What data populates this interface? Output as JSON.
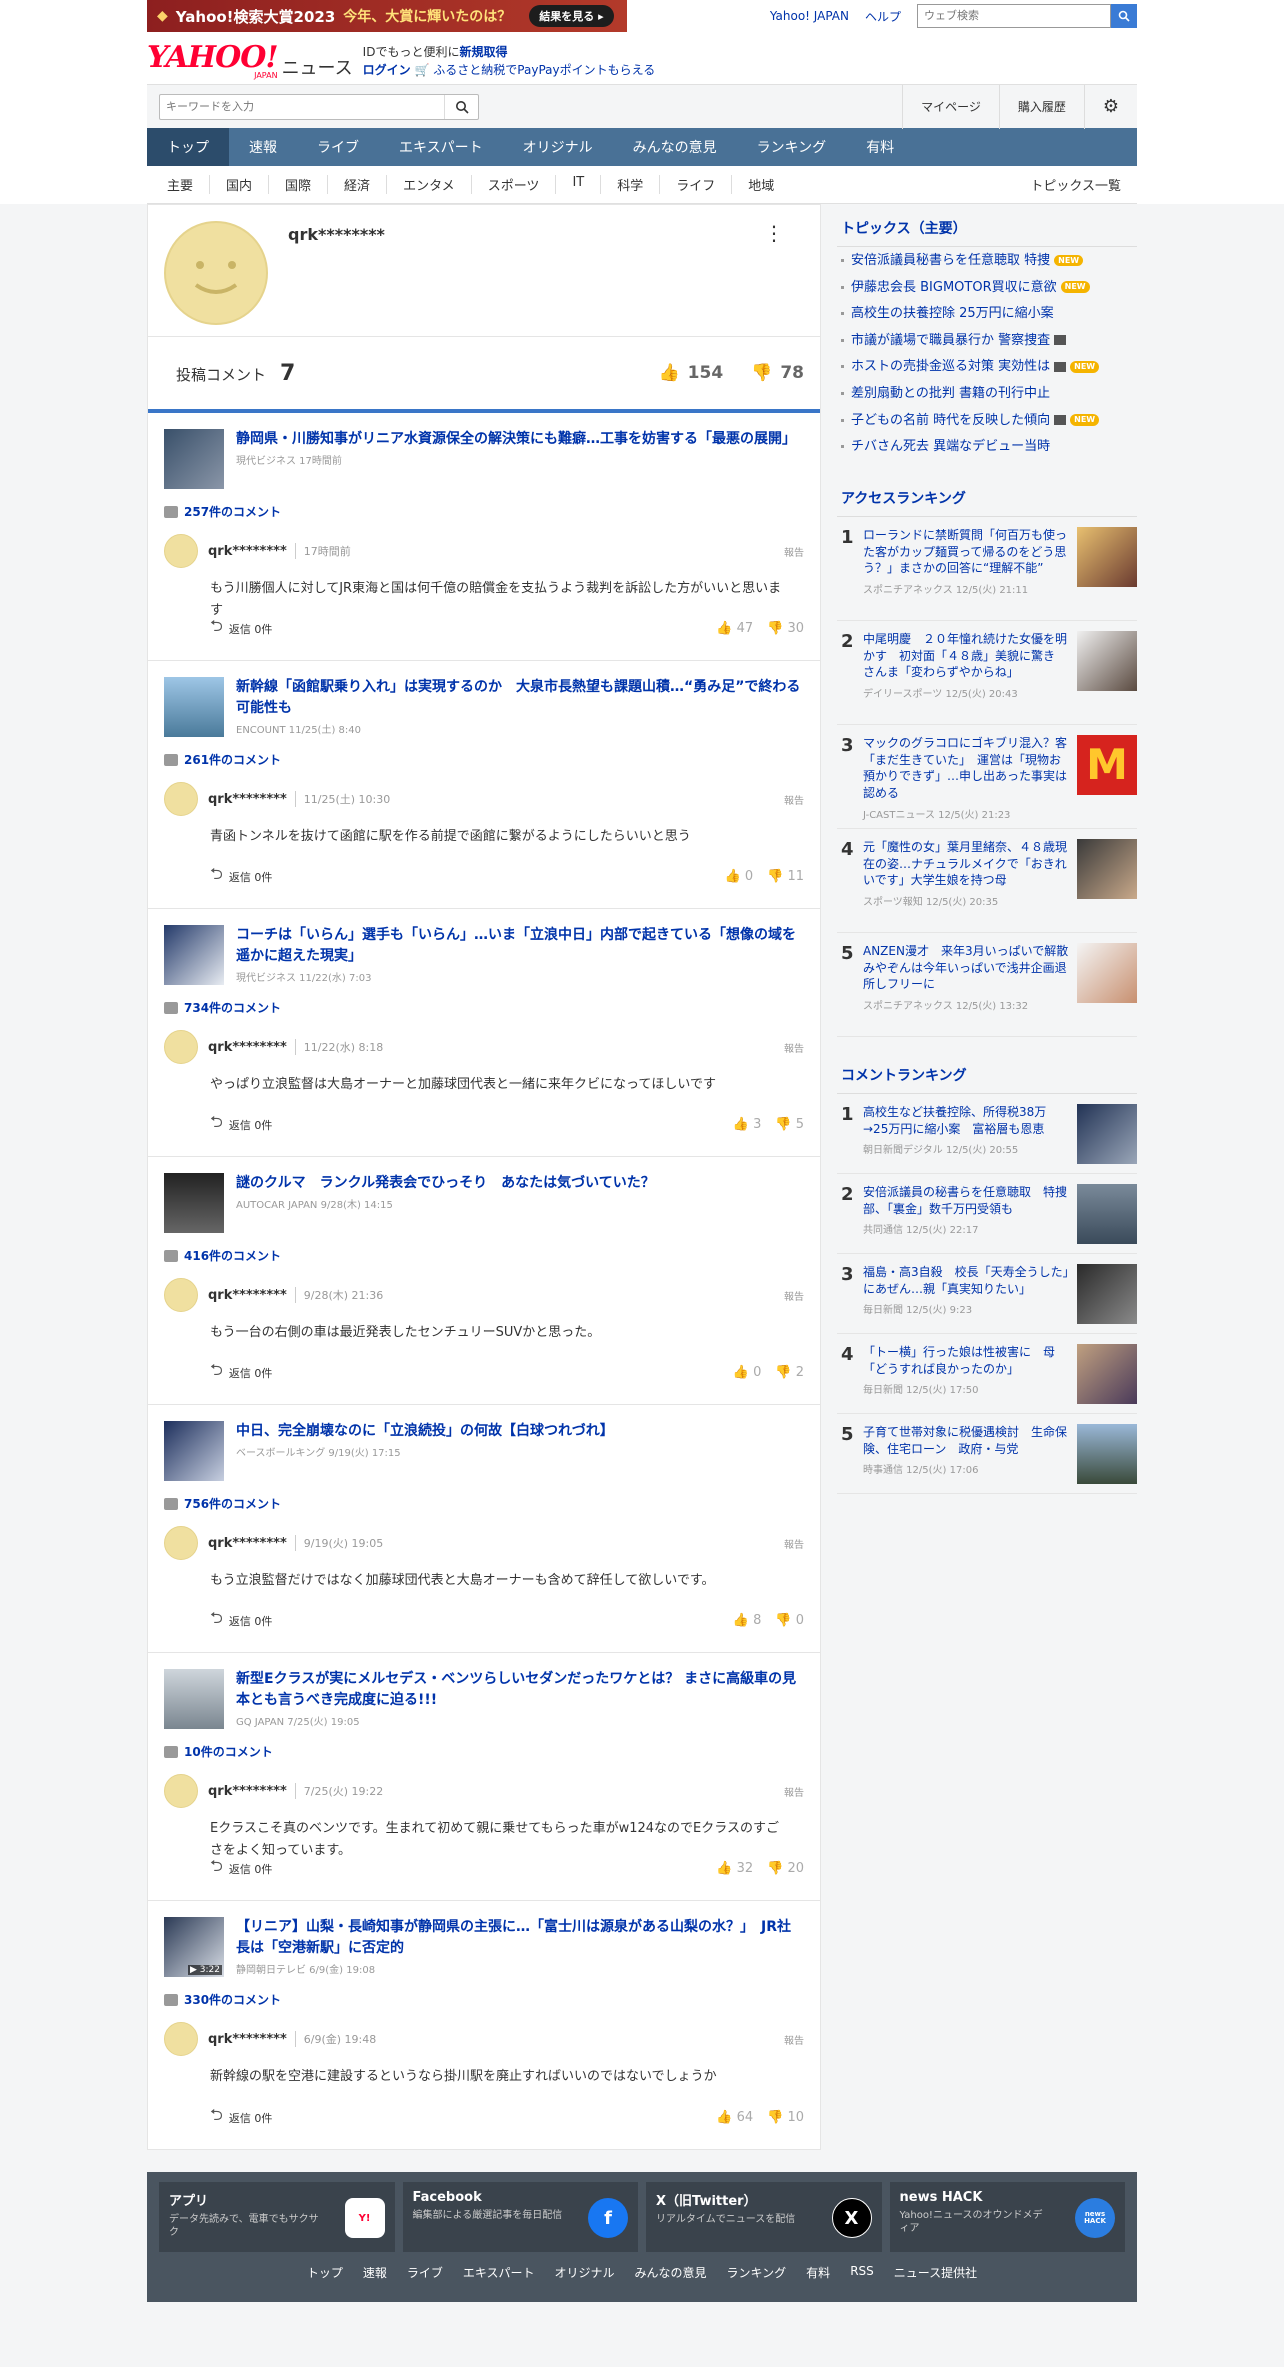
{
  "banner": {
    "title": "Yahoo!検索大賞2023",
    "subtitle": "今年、大賞に輝いたのは？",
    "button": "結果を見る ▸"
  },
  "top_links": {
    "yahoo_japan": "Yahoo! JAPAN",
    "help": "ヘルプ",
    "web_search_placeholder": "ウェブ検索"
  },
  "logo": {
    "yahoo": "YAHOO!",
    "japan": "JAPAN",
    "news": "ニュース"
  },
  "header_promo": {
    "line1_prefix": "IDでもっと便利に",
    "line1_link": "新規取得",
    "line2_login": "ログイン",
    "line2_text": "ふるさと納税でPayPayポイントもらえる"
  },
  "search": {
    "placeholder": "キーワードを入力"
  },
  "right_links": [
    "マイページ",
    "購入履歴"
  ],
  "nav": [
    "トップ",
    "速報",
    "ライブ",
    "エキスパート",
    "オリジナル",
    "みんなの意見",
    "ランキング",
    "有料"
  ],
  "subnav": [
    "主要",
    "国内",
    "国際",
    "経済",
    "エンタメ",
    "スポーツ",
    "IT",
    "科学",
    "ライフ",
    "地域"
  ],
  "subnav_all": "トピックス一覧",
  "profile": {
    "name": "qrk********",
    "comment_label": "投稿コメント",
    "comment_count": "7",
    "likes": "154",
    "dislikes": "78"
  },
  "comments": [
    {
      "title": "静岡県・川勝知事がリニア水資源保全の解決策にも難癖…工事を妨害する「最悪の展開」",
      "source": "現代ビジネス 17時間前",
      "count": "257件のコメント",
      "user": "qrk********",
      "date": "17時間前",
      "report": "報告",
      "text": "もう川勝個人に対してJR東海と国は何千億の賠償金を支払うよう裁判を訴訟した方がいいと思います",
      "reply": "返信 0件",
      "up": "47",
      "down": "30"
    },
    {
      "title": "新幹線「函館駅乗り入れ」は実現するのか　大泉市長熱望も課題山積…“勇み足”で終わる可能性も",
      "source": "ENCOUNT 11/25(土) 8:40",
      "count": "261件のコメント",
      "user": "qrk********",
      "date": "11/25(土) 10:30",
      "report": "報告",
      "text": "青函トンネルを抜けて函館に駅を作る前提で函館に繋がるようにしたらいいと思う",
      "reply": "返信 0件",
      "up": "0",
      "down": "11"
    },
    {
      "title": "コーチは「いらん」選手も「いらん」…いま「立浪中日」内部で起きている「想像の域を遥かに超えた現実」",
      "source": "現代ビジネス 11/22(水) 7:03",
      "count": "734件のコメント",
      "user": "qrk********",
      "date": "11/22(水) 8:18",
      "report": "報告",
      "text": "やっぱり立浪監督は大島オーナーと加藤球団代表と一緒に来年クビになってほしいです",
      "reply": "返信 0件",
      "up": "3",
      "down": "5"
    },
    {
      "title": "謎のクルマ　ランクル発表会でひっそり　あなたは気づいていた？",
      "source": "AUTOCAR JAPAN 9/28(木) 14:15",
      "count": "416件のコメント",
      "user": "qrk********",
      "date": "9/28(木) 21:36",
      "report": "報告",
      "text": "もう一台の右側の車は最近発表したセンチュリーSUVかと思った。",
      "reply": "返信 0件",
      "up": "0",
      "down": "2"
    },
    {
      "title": "中日、完全崩壊なのに「立浪続投」の何故【白球つれづれ】",
      "source": "ベースボールキング 9/19(火) 17:15",
      "count": "756件のコメント",
      "user": "qrk********",
      "date": "9/19(火) 19:05",
      "report": "報告",
      "text": "もう立浪監督だけではなく加藤球団代表と大島オーナーも含めて辞任して欲しいです。",
      "reply": "返信 0件",
      "up": "8",
      "down": "0"
    },
    {
      "title": "新型Eクラスが実にメルセデス・ベンツらしいセダンだったワケとは？ まさに高級車の見本とも言うべき完成度に迫る!!!",
      "source": "GQ JAPAN 7/25(火) 19:05",
      "count": "10件のコメント",
      "user": "qrk********",
      "date": "7/25(火) 19:22",
      "report": "報告",
      "text": "Eクラスこそ真のベンツです。生まれて初めて親に乗せてもらった車がw124なのでEクラスのすごさをよく知っています。",
      "reply": "返信 0件",
      "up": "32",
      "down": "20"
    },
    {
      "title": "【リニア】山梨・長崎知事が静岡県の主張に…「富士川は源泉がある山梨の水？」　JR社長は「空港新駅」に否定的",
      "source": "静岡朝日テレビ 6/9(金) 19:08",
      "count": "330件のコメント",
      "user": "qrk********",
      "date": "6/9(金) 19:48",
      "report": "報告",
      "text": "新幹線の駅を空港に建設するというなら掛川駅を廃止すればいいのではないでしょうか",
      "reply": "返信 0件",
      "up": "64",
      "down": "10"
    }
  ],
  "video_time": "▶ 3:22",
  "topics": {
    "header": "トピックス（主要）",
    "items": [
      {
        "text": "安倍派議員秘書らを任意聴取 特捜",
        "badge": "NEW"
      },
      {
        "text": "伊藤忠会長 BIGMOTOR買収に意欲",
        "badge": "NEW"
      },
      {
        "text": "高校生の扶養控除 25万円に縮小案",
        "badge": ""
      },
      {
        "text": "市議が議場で職員暴行か 警察捜査",
        "badge": "video"
      },
      {
        "text": "ホストの売掛金巡る対策 実効性は",
        "badge": "video-new"
      },
      {
        "text": "差別扇動との批判 書籍の刊行中止",
        "badge": ""
      },
      {
        "text": "子どもの名前 時代を反映した傾向",
        "badge": "video-new"
      },
      {
        "text": "チバさん死去 異端なデビュー当時",
        "badge": ""
      }
    ],
    "new_label": "NEW"
  },
  "access_ranking": {
    "header": "アクセスランキング",
    "items": [
      {
        "num": "1",
        "title": "ローランドに禁断質問「何百万も使った客がカップ麺買って帰るのをどう思う？」まさかの回答に“理解不能”",
        "meta": "スポニチアネックス 12/5(火) 21:11"
      },
      {
        "num": "2",
        "title": "中尾明慶　２０年憧れ続けた女優を明かす　初対面「４８歳」美貌に驚き　さんま「変わらずやからね」",
        "meta": "デイリースポーツ 12/5(火) 20:43"
      },
      {
        "num": "3",
        "title": "マックのグラコロにゴキブリ混入？客「まだ生きていた」　運営は「現物お預かりできず」…申し出あった事実は認める",
        "meta": "J-CASTニュース 12/5(火) 21:23"
      },
      {
        "num": "4",
        "title": "元「魔性の女」葉月里緒奈、４８歳現在の姿…ナチュラルメイクで「おきれいです」大学生娘を持つ母",
        "meta": "スポーツ報知 12/5(火) 20:35"
      },
      {
        "num": "5",
        "title": "ANZEN漫才　来年3月いっぱいで解散　みやぞんは今年いっぱいで浅井企画退所しフリーに",
        "meta": "スポニチアネックス 12/5(火) 13:32"
      }
    ]
  },
  "comment_ranking": {
    "header": "コメントランキング",
    "items": [
      {
        "num": "1",
        "title": "高校生など扶養控除、所得税38万→25万円に縮小案　富裕層も恩恵",
        "meta": "朝日新聞デジタル 12/5(火) 20:55"
      },
      {
        "num": "2",
        "title": "安倍派議員の秘書らを任意聴取　特捜部、「裏金」数千万円受領も",
        "meta": "共同通信 12/5(火) 22:17"
      },
      {
        "num": "3",
        "title": "福島・高3自殺　校長「天寿全うした」にあぜん…親「真実知りたい」",
        "meta": "毎日新聞 12/5(火) 9:23"
      },
      {
        "num": "4",
        "title": "「トー横」行った娘は性被害に　母「どうすれば良かったのか」",
        "meta": "毎日新聞 12/5(火) 17:50"
      },
      {
        "num": "5",
        "title": "子育て世帯対象に税優遇検討　生命保険、住宅ローン　政府・与党",
        "meta": "時事通信 12/5(火) 17:06"
      }
    ]
  },
  "footer": {
    "cards": [
      {
        "title": "アプリ",
        "desc": "データ先読みで、電車でもサクサク"
      },
      {
        "title": "Facebook",
        "desc": "編集部による厳選記事を毎日配信"
      },
      {
        "title": "X（旧Twitter）",
        "desc": "リアルタイムでニュースを配信"
      },
      {
        "title": "news HACK",
        "desc": "Yahoo!ニュースのオウンドメディア"
      }
    ],
    "icons": {
      "facebook": "f",
      "x": "X",
      "hack": "news HACK"
    },
    "links": [
      "トップ",
      "速報",
      "ライブ",
      "エキスパート",
      "オリジナル",
      "みんなの意見",
      "ランキング",
      "有料",
      "RSS",
      "ニュース提供社"
    ]
  },
  "colors": {
    "link": "#0033aa",
    "nav": "#497196",
    "nav_active": "#2c4c6b",
    "accent_blue": "#3a76c8",
    "yahoo_red": "#ff0033"
  }
}
